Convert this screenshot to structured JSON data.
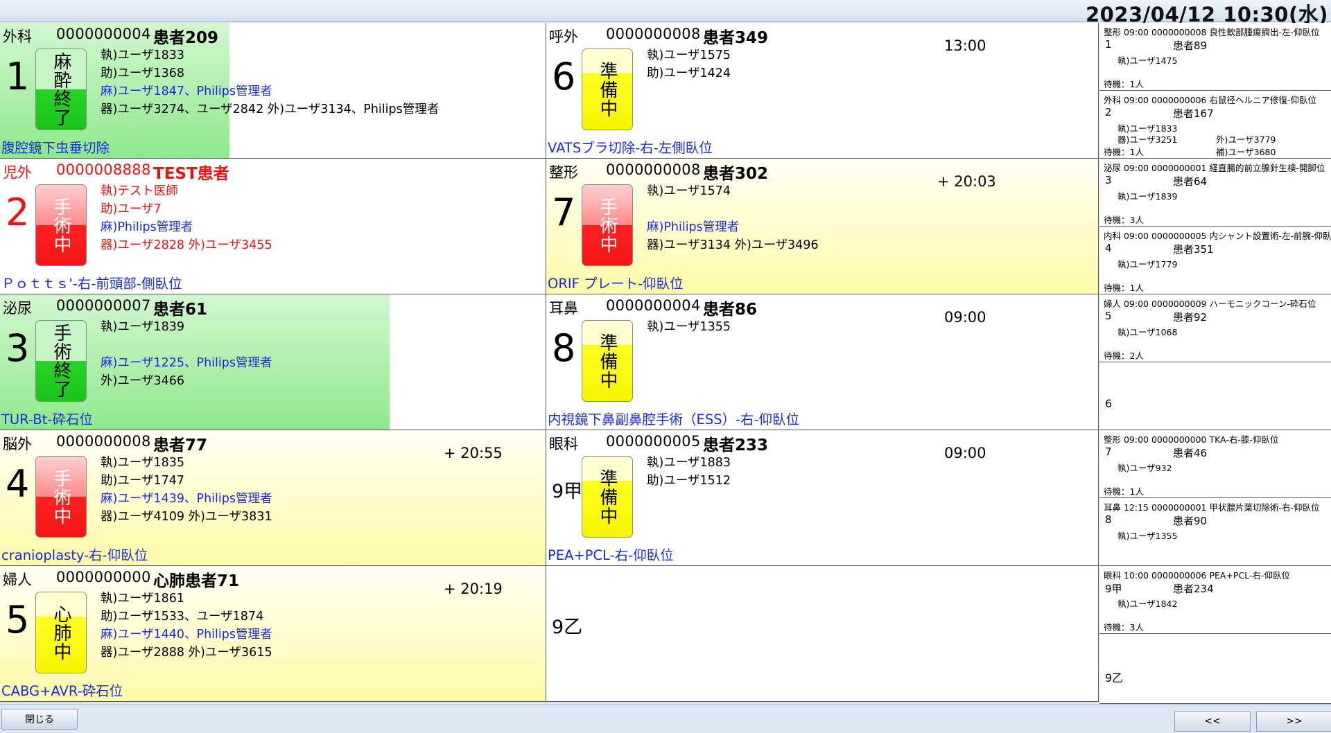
{
  "clock": "2023/04/12  10:30(水)",
  "rooms": [
    {
      "dept": "外科",
      "pid": "0000000004",
      "name": "患者209",
      "room": "1",
      "status": "麻酔終了",
      "timer": "",
      "staff": [
        {
          "t": "執)ユーザ1833",
          "c": ""
        },
        {
          "t": "助)ユーザ1368",
          "c": ""
        },
        {
          "t": "麻)ユーザ1847、Philips管理者",
          "c": "blue"
        },
        {
          "t": "器)ユーザ3274、ユーザ2842  外)ユーザ3134、Philips管理者",
          "c": ""
        }
      ],
      "proc": "腹腔鏡下虫垂切除"
    },
    {
      "dept": "児外",
      "pid": "0000008888",
      "name": "TEST患者",
      "room": "2",
      "status": "手術中",
      "timer": "",
      "staff": [
        {
          "t": "執)テスト医師",
          "c": "red"
        },
        {
          "t": "助)ユーザ7",
          "c": "red"
        },
        {
          "t": "麻)Philips管理者",
          "c": "blue"
        },
        {
          "t": "器)ユーザ2828  外)ユーザ3455",
          "c": "red"
        }
      ],
      "proc": "Ｐｏｔｔｓ'-右-前頭部-側臥位"
    },
    {
      "dept": "泌尿",
      "pid": "0000000007",
      "name": "患者61",
      "room": "3",
      "status": "手術終了",
      "timer": "",
      "staff": [
        {
          "t": "執)ユーザ1839",
          "c": ""
        },
        {
          "t": "",
          "c": ""
        },
        {
          "t": "麻)ユーザ1225、Philips管理者",
          "c": "blue"
        },
        {
          "t": "外)ユーザ3466",
          "c": ""
        }
      ],
      "proc": "TUR-Bt-砕石位"
    },
    {
      "dept": "脳外",
      "pid": "0000000008",
      "name": "患者77",
      "room": "4",
      "status": "手術中",
      "timer": "+ 20:55",
      "staff": [
        {
          "t": "執)ユーザ1835",
          "c": ""
        },
        {
          "t": "助)ユーザ1747",
          "c": ""
        },
        {
          "t": "麻)ユーザ1439、Philips管理者",
          "c": "blue"
        },
        {
          "t": "器)ユーザ4109  外)ユーザ3831",
          "c": ""
        }
      ],
      "proc": "cranioplasty-右-仰臥位"
    },
    {
      "dept": "婦人",
      "pid": "0000000000",
      "name": "心肺患者71",
      "room": "5",
      "status": "心肺中",
      "timer": "+ 20:19",
      "staff": [
        {
          "t": "執)ユーザ1861",
          "c": ""
        },
        {
          "t": "助)ユーザ1533、ユーザ1874",
          "c": ""
        },
        {
          "t": "麻)ユーザ1440、Philips管理者",
          "c": "blue"
        },
        {
          "t": "器)ユーザ2888  外)ユーザ3615",
          "c": ""
        }
      ],
      "proc": "CABG+AVR-砕石位"
    },
    {
      "dept": "呼外",
      "pid": "0000000008",
      "name": "患者349",
      "room": "6",
      "status": "準備中",
      "timer": "13:00",
      "staff": [
        {
          "t": "執)ユーザ1575",
          "c": ""
        },
        {
          "t": "助)ユーザ1424",
          "c": ""
        }
      ],
      "proc": "VATSブラ切除-右-左側臥位"
    },
    {
      "dept": "整形",
      "pid": "0000000008",
      "name": "患者302",
      "room": "7",
      "status": "手術中",
      "timer": "+ 20:03",
      "staff": [
        {
          "t": "執)ユーザ1574",
          "c": ""
        },
        {
          "t": "",
          "c": ""
        },
        {
          "t": "麻)Philips管理者",
          "c": "blue"
        },
        {
          "t": "器)ユーザ3134  外)ユーザ3496",
          "c": ""
        }
      ],
      "proc": "ORIF  プレート-仰臥位"
    },
    {
      "dept": "耳鼻",
      "pid": "0000000004",
      "name": "患者86",
      "room": "8",
      "status": "準備中",
      "timer": "09:00",
      "staff": [
        {
          "t": "執)ユーザ1355",
          "c": ""
        }
      ],
      "proc": "内視鏡下鼻副鼻腔手術（ESS）-右-仰臥位"
    },
    {
      "dept": "眼科",
      "pid": "0000000005",
      "name": "患者233",
      "room": "9甲",
      "status": "準備中",
      "timer": "09:00",
      "staff": [
        {
          "t": "執)ユーザ1883",
          "c": ""
        },
        {
          "t": "助)ユーザ1512",
          "c": ""
        }
      ],
      "proc": "PEA+PCL-右-仰臥位"
    },
    {
      "dept": "",
      "pid": "",
      "name": "",
      "room": "9乙",
      "status": "",
      "timer": "",
      "staff": [],
      "proc": ""
    }
  ],
  "queue": [
    {
      "hdr": "整形  09:00  0000000008  良性軟部腫瘍摘出-左-仰臥位",
      "seq": "1",
      "name": "患者89",
      "lines": [
        "執)ユーザ1475"
      ],
      "extra": "",
      "wait": "待機：1人"
    },
    {
      "hdr": "外科  09:00  0000000006  右鼠径ヘルニア修復-仰臥位",
      "seq": "2",
      "name": "患者167",
      "lines": [
        "執)ユーザ1833",
        "器)ユーザ3251"
      ],
      "extra": "外)ユーザ3779",
      "extra2": "補)ユーザ3680",
      "wait": "待機：1人"
    },
    {
      "hdr": "泌尿  09:00  0000000001  経直腸的前立腺針生検-開脚位",
      "seq": "3",
      "name": "患者64",
      "lines": [
        "執)ユーザ1839"
      ],
      "extra": "",
      "wait": "待機：3人"
    },
    {
      "hdr": "内科  09:00  0000000005  内シャント設置術-左-前腕-仰臥位",
      "seq": "4",
      "name": "患者351",
      "lines": [
        "執)ユーザ1779"
      ],
      "extra": "",
      "wait": "待機：1人"
    },
    {
      "hdr": "婦人  09:00  0000000009  ハーモニックコーン-砕石位",
      "seq": "5",
      "name": "患者92",
      "lines": [
        "執)ユーザ1068"
      ],
      "extra": "",
      "wait": "待機：2人"
    },
    {
      "big": "6"
    },
    {
      "hdr": "整形  09:00  0000000000  TKA-右-膝-仰臥位",
      "seq": "7",
      "name": "患者46",
      "lines": [
        "執)ユーザ932"
      ],
      "extra": "",
      "wait": "待機：1人"
    },
    {
      "hdr": "耳鼻  12:15  0000000001  甲状腺片葉切除術-右-仰臥位",
      "seq": "8",
      "name": "患者90",
      "lines": [
        "執)ユーザ1355"
      ],
      "extra": "",
      "wait": ""
    },
    {
      "hdr": "眼科  10:00  0000000006  PEA+PCL-右-仰臥位",
      "seq": "9甲",
      "name": "患者234",
      "lines": [
        "執)ユーザ1842"
      ],
      "extra": "",
      "wait": "待機：3人"
    },
    {
      "big": "9乙"
    }
  ],
  "buttons": {
    "close": "閉じる",
    "prev": "<<",
    "next": ">>"
  }
}
